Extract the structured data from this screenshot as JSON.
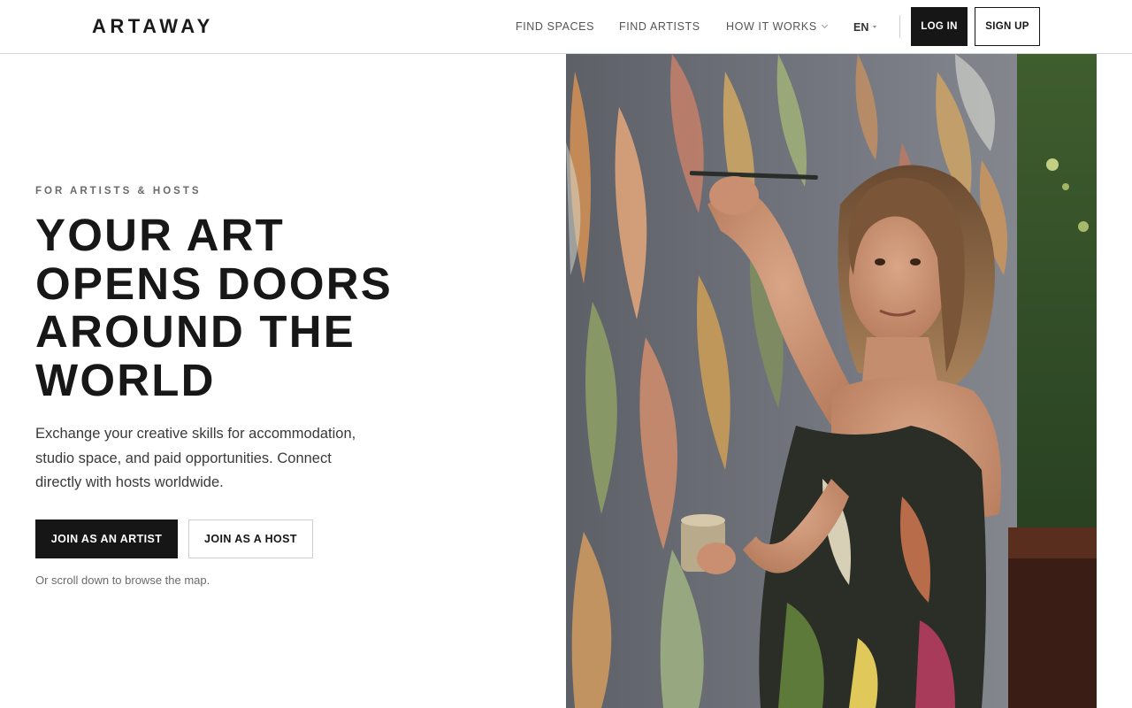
{
  "header": {
    "logo": "ARTAWAY",
    "nav": {
      "find_spaces": "FIND SPACES",
      "find_artists": "FIND ARTISTS",
      "how_it_works": "HOW IT WORKS"
    },
    "language": "EN",
    "login_label": "LOG IN",
    "signup_label": "SIGN UP"
  },
  "hero": {
    "eyebrow": "FOR ARTISTS & HOSTS",
    "headline_lines": [
      "YOUR ART",
      "OPENS DOORS",
      "AROUND THE",
      "WORLD"
    ],
    "subtext": "Exchange your creative skills for accommodation, studio space, and paid opportunities. Connect directly with hosts worldwide.",
    "primary_cta": "JOIN AS AN ARTIST",
    "secondary_cta": "JOIN AS A HOST",
    "hint": "Or scroll down to browse the map."
  },
  "image": {
    "subject": "artist-painting-mural-photo"
  },
  "colors": {
    "primary": "#161616",
    "background": "#ffffff",
    "muted_text": "#6b6b6b"
  }
}
